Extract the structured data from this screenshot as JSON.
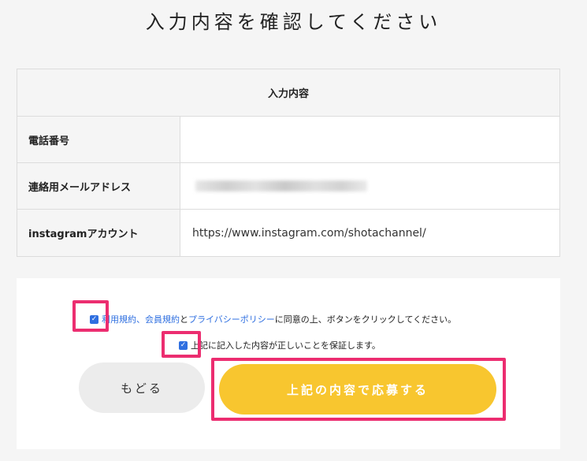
{
  "page": {
    "title": "入力内容を確認してください"
  },
  "table": {
    "header": "入力内容",
    "rows": [
      {
        "label": "電話番号",
        "value": ""
      },
      {
        "label": "連絡用メールアドレス",
        "value": ""
      },
      {
        "label": "instagramアカウント",
        "value": "https://www.instagram.com/shotachannel/"
      }
    ]
  },
  "agreement": {
    "terms": {
      "checked": true,
      "link_usage": "利用規約",
      "separator": "、",
      "link_member": "会員規約",
      "conjunction": "と",
      "link_privacy": "プライバシーポリシー",
      "suffix": "に同意の上、ボタンをクリックしてください。"
    },
    "accuracy": {
      "checked": true,
      "text": "上記に記入した内容が正しいことを保証します。"
    }
  },
  "buttons": {
    "back_label": "もどる",
    "submit_label": "上記の内容で応募する"
  },
  "colors": {
    "accent_yellow": "#f8c62f",
    "link_blue": "#2f6fe0",
    "highlight_pink": "#ec2d70"
  }
}
